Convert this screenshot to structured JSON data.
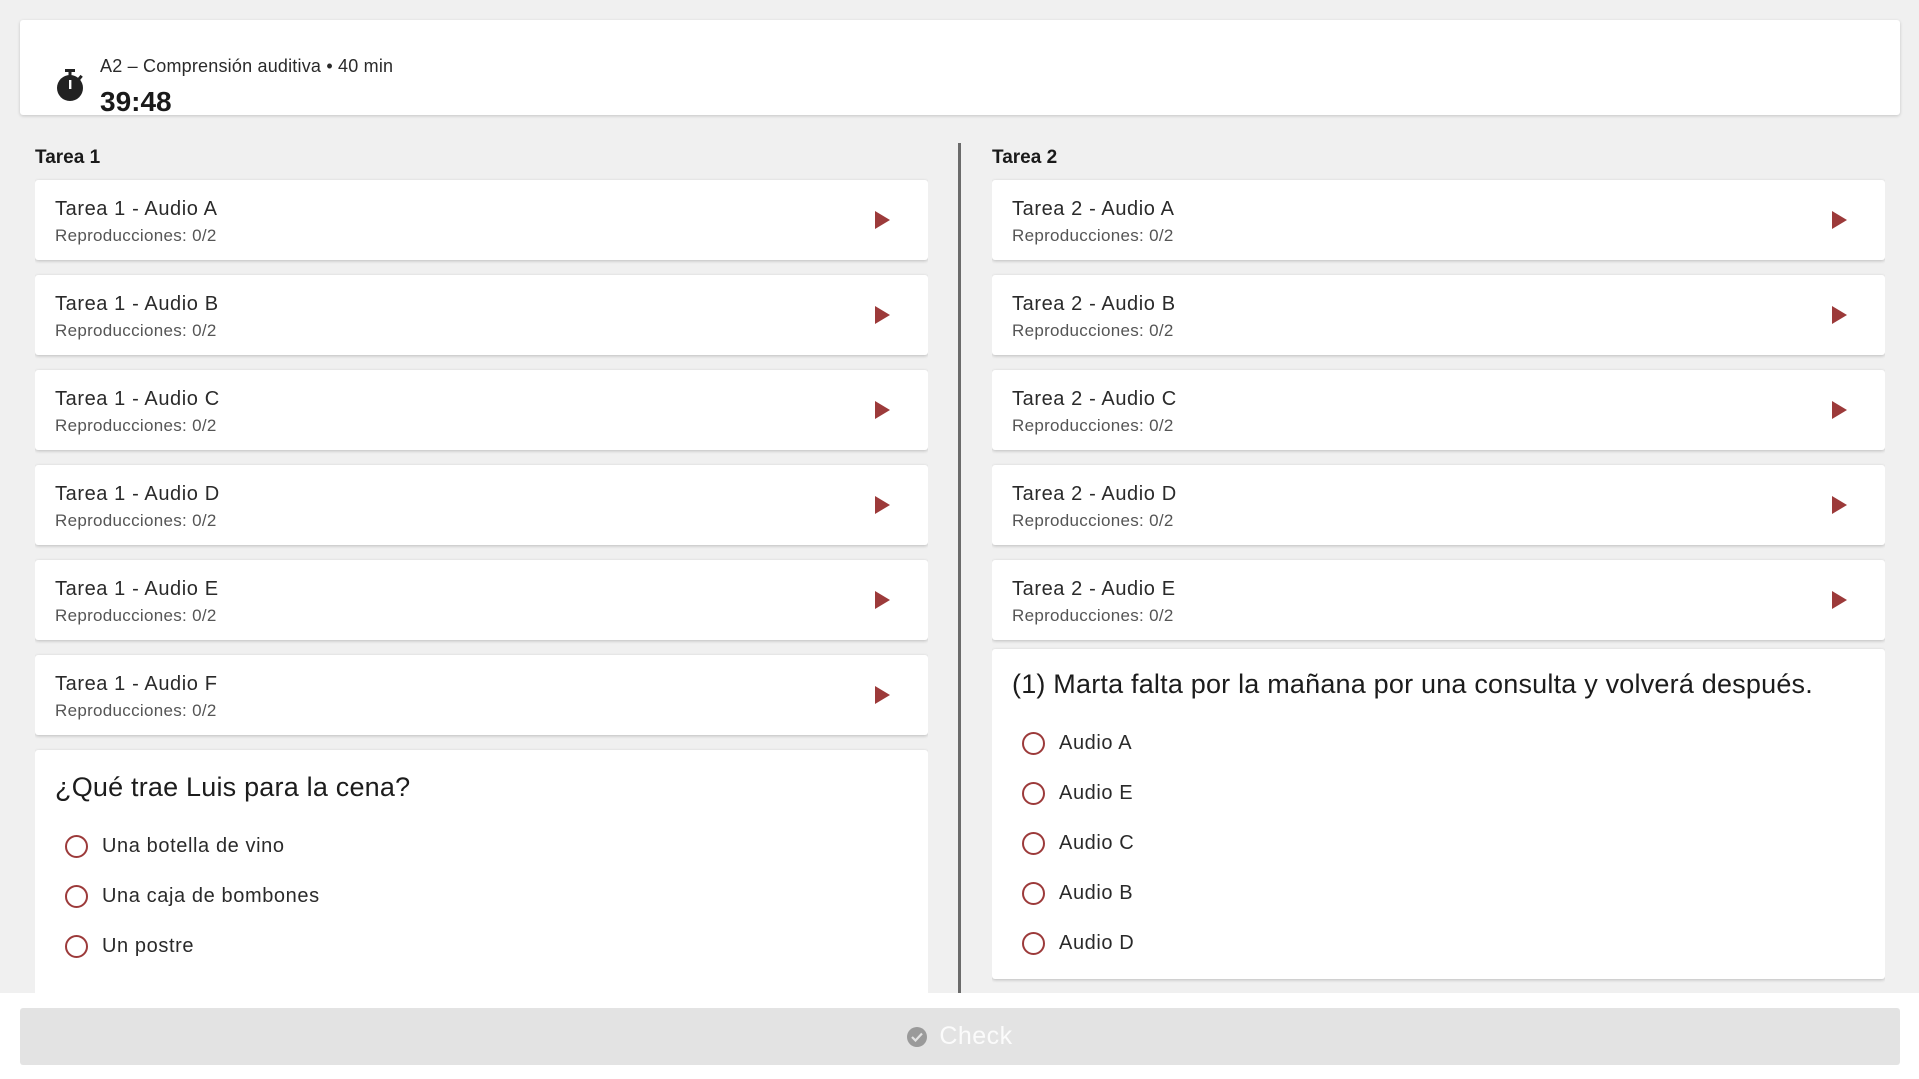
{
  "header": {
    "subtitle": "A2 – Comprensión auditiva • 40 min",
    "time": "39:48"
  },
  "tarea1": {
    "title": "Tarea 1",
    "audios": [
      {
        "title": "Tarea 1 - Audio A",
        "plays": "Reproducciones: 0/2"
      },
      {
        "title": "Tarea 1 - Audio B",
        "plays": "Reproducciones: 0/2"
      },
      {
        "title": "Tarea 1 - Audio C",
        "plays": "Reproducciones: 0/2"
      },
      {
        "title": "Tarea 1 - Audio D",
        "plays": "Reproducciones: 0/2"
      },
      {
        "title": "Tarea 1 - Audio E",
        "plays": "Reproducciones: 0/2"
      },
      {
        "title": "Tarea 1 - Audio F",
        "plays": "Reproducciones: 0/2"
      }
    ],
    "question": {
      "text": "¿Qué trae Luis para la cena?",
      "options": [
        "Una botella de vino",
        "Una caja de bombones",
        "Un postre"
      ]
    }
  },
  "tarea2": {
    "title": "Tarea 2",
    "audios": [
      {
        "title": "Tarea 2 - Audio A",
        "plays": "Reproducciones: 0/2"
      },
      {
        "title": "Tarea 2 - Audio B",
        "plays": "Reproducciones: 0/2"
      },
      {
        "title": "Tarea 2 - Audio C",
        "plays": "Reproducciones: 0/2"
      },
      {
        "title": "Tarea 2 - Audio D",
        "plays": "Reproducciones: 0/2"
      },
      {
        "title": "Tarea 2 - Audio E",
        "plays": "Reproducciones: 0/2"
      }
    ],
    "question": {
      "text": "(1) Marta falta por la mañana por una consulta y volverá después.",
      "options": [
        "Audio A",
        "Audio E",
        "Audio C",
        "Audio B",
        "Audio D"
      ]
    }
  },
  "footer": {
    "check_label": "Check"
  },
  "colors": {
    "accent": "#9c3a3a",
    "background": "#f0f0f0",
    "button_disabled": "#e3e3e3"
  }
}
